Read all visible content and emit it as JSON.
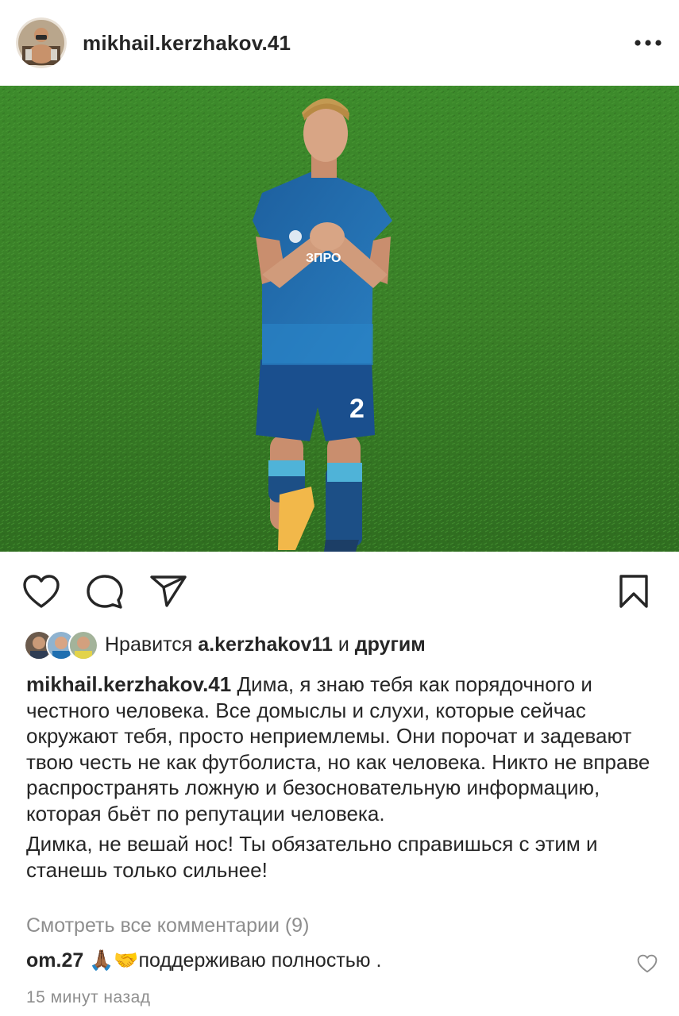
{
  "post": {
    "username": "mikhail.kerzhakov.41",
    "photo_description_icon": "football-player-photo"
  },
  "likes": {
    "prefix": "Нравится",
    "user": "a.kerzhakov11",
    "and": "и",
    "others": "другим"
  },
  "caption": {
    "username": "mikhail.kerzhakov.41",
    "paragraph1": "Дима, я знаю тебя как порядочного и честного человека. Все домыслы и слухи, которые сейчас окружают тебя, просто неприемлемы. Они порочат и задевают твою честь не как футболиста, но как человека. Никто  не вправе распространять ложную и безосновательную информацию, которая бьёт по репутации человека.",
    "paragraph2": "Димка, не вешай нос! Ты обязательно справишься с этим и станешь только сильнее!"
  },
  "view_comments": "Смотреть все комментарии (9)",
  "comment": {
    "username": "om.27",
    "emoji": "🙏🏾🤝",
    "text": "поддерживаю полностью ."
  },
  "timestamp": "15 минут назад",
  "icons": {
    "like": "heart-icon",
    "comment": "comment-bubble-icon",
    "share": "paper-plane-icon",
    "save": "bookmark-icon",
    "more": "more-dots-icon"
  },
  "colors": {
    "text": "#262626",
    "secondary": "#8e8e8e",
    "grass": "#3f8a2a",
    "jersey": "#1f6fb0"
  }
}
